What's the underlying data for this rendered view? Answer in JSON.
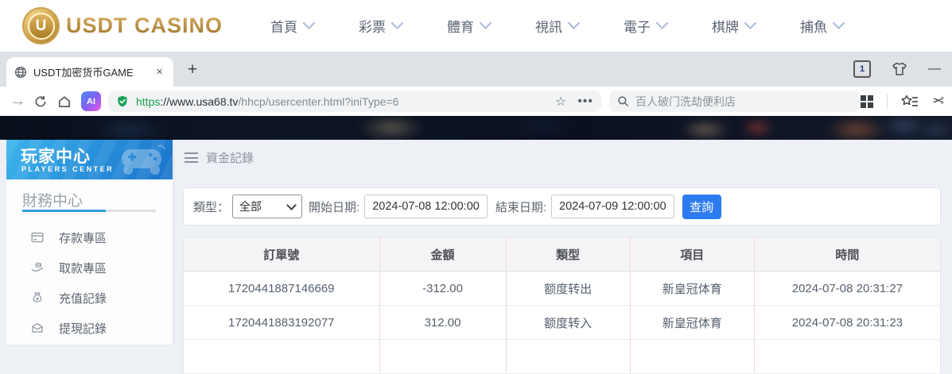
{
  "casino_nav": {
    "logo_letter": "U",
    "logo_text": "USDT CASINO",
    "items": [
      {
        "label": "首頁"
      },
      {
        "label": "彩票"
      },
      {
        "label": "體育"
      },
      {
        "label": "視訊"
      },
      {
        "label": "電子"
      },
      {
        "label": "棋牌"
      },
      {
        "label": "捕魚"
      }
    ]
  },
  "browser": {
    "tab_title": "USDT加密货币GAME",
    "tab_close": "×",
    "new_tab": "+",
    "tab_counter": "1",
    "minimize": "—",
    "forward_arrow": "→",
    "url_scheme": "https",
    "url_host": "://www.usa68.tv",
    "url_path": "/hhcp/usercenter.html?iniType=6",
    "addr_star": "☆",
    "addr_more": "•••",
    "search_placeholder": "百人破门洗劫便利店",
    "scissors": "✂"
  },
  "sidebar": {
    "header_title": "玩家中心",
    "header_subtitle": "PLAYERS  CENTER",
    "section_title": "財務中心",
    "items": [
      {
        "label": "存款專區",
        "icon": "deposit-card-icon"
      },
      {
        "label": "取款專區",
        "icon": "withdraw-hand-icon"
      },
      {
        "label": "充值記錄",
        "icon": "moneybag-icon"
      },
      {
        "label": "提現記錄",
        "icon": "wallet-icon"
      }
    ]
  },
  "main": {
    "page_title": "資金記錄",
    "filters": {
      "type_label": "類型：",
      "type_value": "全部",
      "start_label": "開始日期:",
      "start_value": "2024-07-08 12:00:00",
      "end_label": "結束日期:",
      "end_value": "2024-07-09 12:00:00",
      "query_button": "查詢"
    },
    "table": {
      "columns": [
        "訂單號",
        "金額",
        "類型",
        "項目",
        "時間"
      ],
      "rows": [
        [
          "1720441887146669",
          "-312.00",
          "额度转出",
          "新皇冠体育",
          "2024-07-08 20:31:27"
        ],
        [
          "1720441883192077",
          "312.00",
          "额度转入",
          "新皇冠体育",
          "2024-07-08 20:31:23"
        ]
      ]
    }
  },
  "colors": {
    "accent_blue": "#2d7bf0",
    "sidebar_blue_top": "#3db4ec",
    "sidebar_blue_bottom": "#1b74cb",
    "logo_gold": "#b8913f",
    "shield_green": "#17a257",
    "table_divider_pink": "#f2d8d8",
    "banner_dark": "#0b101c"
  }
}
